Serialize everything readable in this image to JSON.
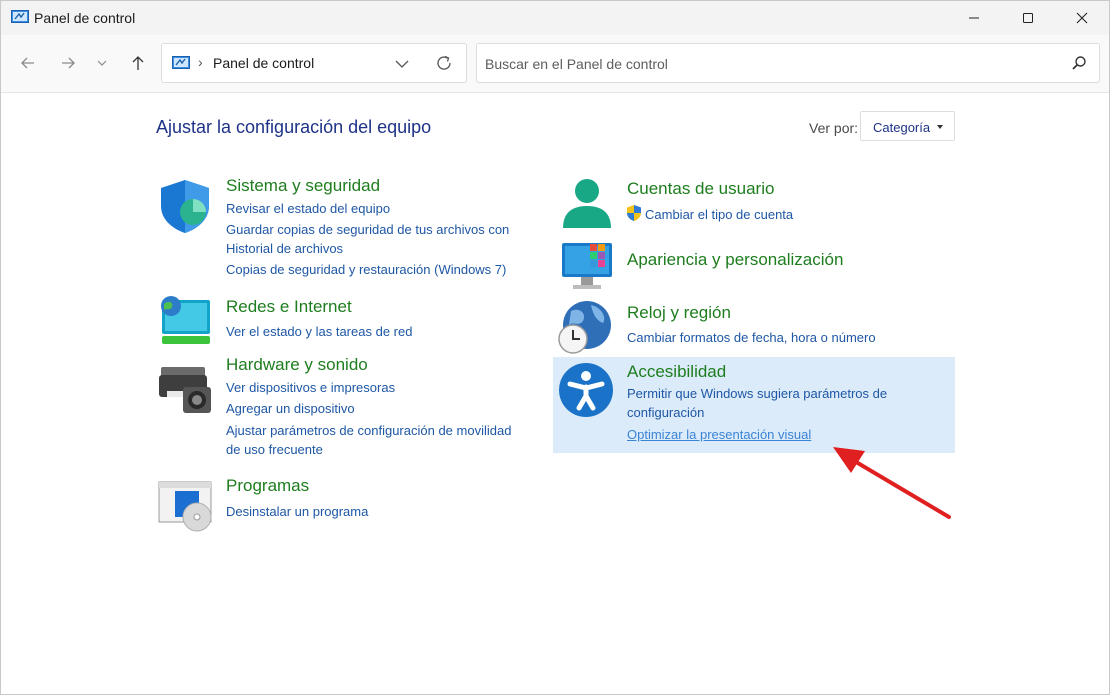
{
  "window": {
    "title": "Panel de control"
  },
  "toolbar": {
    "address_text": "Panel de control",
    "search_placeholder": "Buscar en el Panel de control"
  },
  "main": {
    "heading": "Ajustar la configuración del equipo",
    "view_by_label": "Ver por:",
    "view_by_value": "Categoría"
  },
  "categories": {
    "sistema": {
      "title": "Sistema y seguridad",
      "links": [
        "Revisar el estado del equipo",
        "Guardar copias de seguridad de tus archivos con",
        "Historial de archivos",
        "Copias de seguridad y restauración (Windows 7)"
      ]
    },
    "redes": {
      "title": "Redes e Internet",
      "links": [
        "Ver el estado y las tareas de red"
      ]
    },
    "hardware": {
      "title": "Hardware y sonido",
      "links": [
        "Ver dispositivos e impresoras",
        "Agregar un dispositivo",
        "Ajustar parámetros de configuración de movilidad",
        "de uso frecuente"
      ]
    },
    "programas": {
      "title": "Programas",
      "links": [
        "Desinstalar un programa"
      ]
    },
    "cuentas": {
      "title": "Cuentas de usuario",
      "links": [
        "Cambiar el tipo de cuenta"
      ]
    },
    "apariencia": {
      "title": "Apariencia y personalización",
      "links": []
    },
    "reloj": {
      "title": "Reloj y región",
      "links": [
        "Cambiar formatos de fecha, hora o número"
      ]
    },
    "accesibilidad": {
      "title": "Accesibilidad",
      "links": [
        "Permitir que Windows sugiera parámetros de",
        "configuración",
        "Optimizar la presentación visual"
      ]
    }
  },
  "colors": {
    "title_green": "#1e7d1e",
    "link_blue": "#1e57a5",
    "heading_blue": "#1e3287",
    "highlight": "#dcebfa",
    "arrow_red": "#e02020"
  }
}
